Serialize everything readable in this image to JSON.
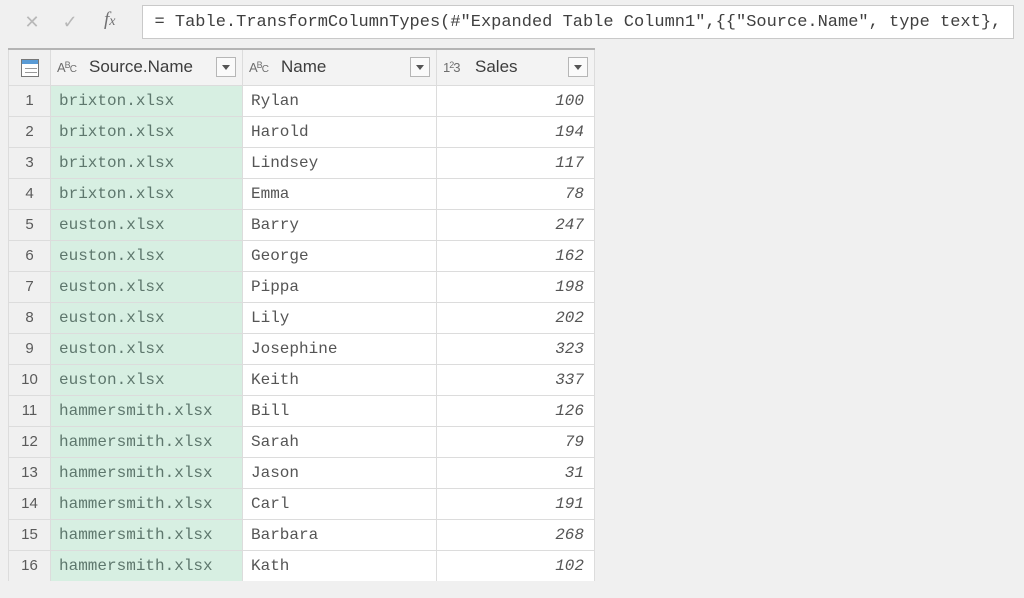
{
  "formula_bar": {
    "formula": "= Table.TransformColumnTypes(#\"Expanded Table Column1\",{{\"Source.Name\", type text},"
  },
  "columns": {
    "c0": {
      "label": "Source.Name",
      "type_icon": "ABC"
    },
    "c1": {
      "label": "Name",
      "type_icon": "ABC"
    },
    "c2": {
      "label": "Sales",
      "type_icon": "123"
    }
  },
  "rows": [
    {
      "n": "1",
      "source": "brixton.xlsx",
      "name": "Rylan",
      "sales": "100"
    },
    {
      "n": "2",
      "source": "brixton.xlsx",
      "name": "Harold",
      "sales": "194"
    },
    {
      "n": "3",
      "source": "brixton.xlsx",
      "name": "Lindsey",
      "sales": "117"
    },
    {
      "n": "4",
      "source": "brixton.xlsx",
      "name": "Emma",
      "sales": "78"
    },
    {
      "n": "5",
      "source": "euston.xlsx",
      "name": "Barry",
      "sales": "247"
    },
    {
      "n": "6",
      "source": "euston.xlsx",
      "name": "George",
      "sales": "162"
    },
    {
      "n": "7",
      "source": "euston.xlsx",
      "name": "Pippa",
      "sales": "198"
    },
    {
      "n": "8",
      "source": "euston.xlsx",
      "name": "Lily",
      "sales": "202"
    },
    {
      "n": "9",
      "source": "euston.xlsx",
      "name": "Josephine",
      "sales": "323"
    },
    {
      "n": "10",
      "source": "euston.xlsx",
      "name": "Keith",
      "sales": "337"
    },
    {
      "n": "11",
      "source": "hammersmith.xlsx",
      "name": "Bill",
      "sales": "126"
    },
    {
      "n": "12",
      "source": "hammersmith.xlsx",
      "name": "Sarah",
      "sales": "79"
    },
    {
      "n": "13",
      "source": "hammersmith.xlsx",
      "name": "Jason",
      "sales": "31"
    },
    {
      "n": "14",
      "source": "hammersmith.xlsx",
      "name": "Carl",
      "sales": "191"
    },
    {
      "n": "15",
      "source": "hammersmith.xlsx",
      "name": "Barbara",
      "sales": "268"
    },
    {
      "n": "16",
      "source": "hammersmith.xlsx",
      "name": "Kath",
      "sales": "102"
    }
  ]
}
